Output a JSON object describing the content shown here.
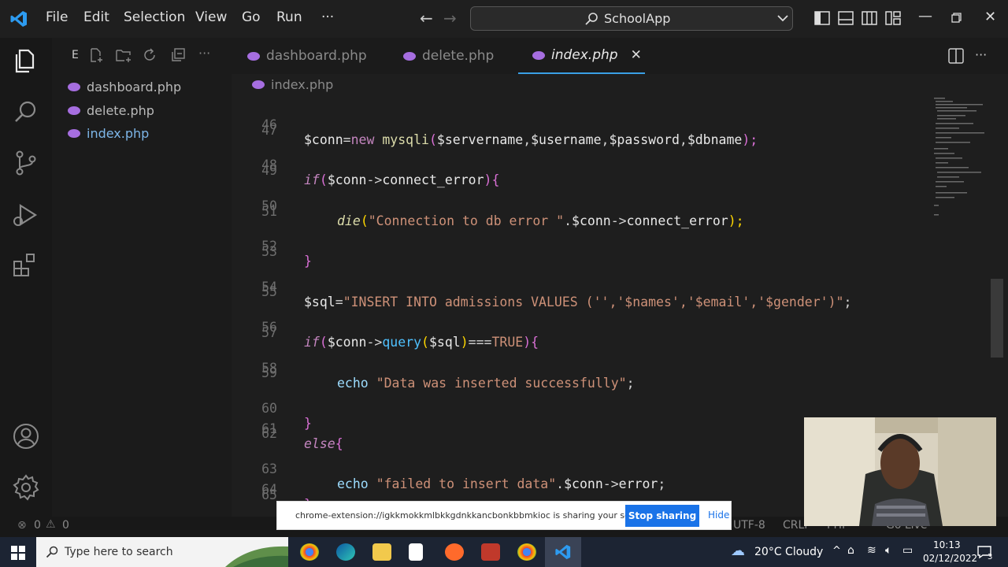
{
  "titlebar": {
    "menu": [
      "File",
      "Edit",
      "Selection",
      "View",
      "Go",
      "Run",
      "···"
    ],
    "search_text": "SchoolApp"
  },
  "explorer": {
    "header": "E",
    "files": [
      "dashboard.php",
      "delete.php",
      "index.php"
    ]
  },
  "tabs": [
    {
      "label": "dashboard.php"
    },
    {
      "label": "delete.php"
    },
    {
      "label": "index.php"
    }
  ],
  "breadcrumb": "index.php",
  "code_lines": [
    {
      "n": "46"
    },
    {
      "n": "47"
    },
    {
      "n": "48"
    },
    {
      "n": "49"
    },
    {
      "n": "50"
    },
    {
      "n": "51"
    },
    {
      "n": "52"
    },
    {
      "n": "53"
    },
    {
      "n": "54"
    },
    {
      "n": "55"
    },
    {
      "n": "56"
    },
    {
      "n": "57"
    },
    {
      "n": "58"
    },
    {
      "n": "59"
    },
    {
      "n": "60"
    },
    {
      "n": "61"
    },
    {
      "n": "62"
    },
    {
      "n": "63"
    },
    {
      "n": "64"
    },
    {
      "n": "65"
    }
  ],
  "code": {
    "l46": [
      "$conn",
      "=",
      "new",
      " ",
      "mysqli",
      "(",
      "$servername",
      ",",
      "$username",
      ",",
      "$password",
      ",",
      "$dbname",
      ");"
    ],
    "l48": [
      "if",
      "(",
      "$conn",
      "->",
      "connect_error",
      ")",
      "{"
    ],
    "l50": [
      "die",
      "(",
      "\"Connection to db error \"",
      ".",
      "$conn",
      "->",
      "connect_error",
      ");"
    ],
    "l52": [
      "}"
    ],
    "l54": [
      "$sql",
      "=",
      "\"INSERT INTO admissions VALUES ('','$names','$email','$gender')\"",
      ";"
    ],
    "l56": [
      "if",
      "(",
      "$conn",
      "->",
      "query",
      "(",
      "$sql",
      ")",
      "===",
      "TRUE",
      ")",
      "{"
    ],
    "l58": [
      "echo",
      " ",
      "\"Data was inserted successfully\"",
      ";"
    ],
    "l60": [
      "}"
    ],
    "l61": [
      "else",
      "{"
    ],
    "l63": [
      "echo",
      " ",
      "\"failed to insert data\"",
      ".",
      "$conn",
      "->",
      "error",
      ";"
    ],
    "l64": [
      "}"
    ]
  },
  "statusbar": {
    "errors": "0",
    "warnings": "0",
    "encoding": "UTF-8",
    "eol": "CRLF",
    "language": "PHP",
    "golive": "Go Live"
  },
  "share_bar": {
    "message": "chrome-extension://igkkmokkmlbkkgdnkkancbonkbbmkioc is sharing your screen.",
    "stop_label": "Stop sharing",
    "hide_label": "Hide"
  },
  "taskbar": {
    "search_placeholder": "Type here to search",
    "weather": "20°C  Cloudy",
    "time": "10:13",
    "date": "02/12/2022",
    "notif_count": "3"
  },
  "colors": {
    "accent": "#3a9fe6",
    "php_icon": "#a66ee0",
    "stop_button": "#1a73e8"
  }
}
